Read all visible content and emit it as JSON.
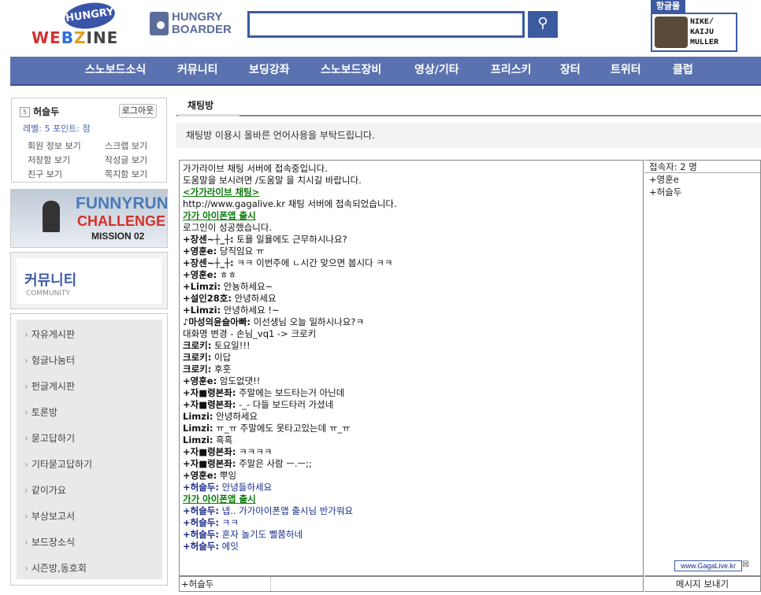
{
  "header": {
    "webzine_logo": {
      "hungry": "HUNGRY",
      "letters": [
        "WE",
        "B",
        "Z",
        "INE"
      ]
    },
    "boarder_logo": {
      "line1": "HUNGRY",
      "line2": "BOARDER"
    },
    "search": {
      "value": "",
      "placeholder": ""
    },
    "ad": {
      "tag": "항글몰",
      "text": [
        "NIKE/",
        "KAIJU",
        "MULLER"
      ]
    },
    "accent_color": "#3c5aa0"
  },
  "nav": {
    "items": [
      {
        "label": "스노보드소식"
      },
      {
        "label": "커뮤니티"
      },
      {
        "label": "보딩강좌"
      },
      {
        "label": "스노보드장비"
      },
      {
        "label": "영상/기타"
      },
      {
        "label": "프리스키"
      },
      {
        "label": "장터"
      },
      {
        "label": "트위터"
      },
      {
        "label": "클럽"
      }
    ]
  },
  "sidebar": {
    "user": {
      "name": "허슬두",
      "logout_label": "로그아웃",
      "level_text": "레벨: 5  포인트:         점"
    },
    "links": [
      "회원 정보 보기",
      "스크랩 보기",
      "저장함 보기",
      "작성글 보기",
      "친구 보기",
      "쪽지함 보기"
    ],
    "banner": {
      "line1": "FUNNYRUN",
      "line2": "CHALLENGE",
      "line3": "MISSION 02"
    },
    "community": {
      "title": "커뮤니티",
      "subtitle": "COMMUNITY"
    },
    "menu": [
      "자유게시판",
      "헝글나눔터",
      "펀글게시판",
      "토론방",
      "묻고답하기",
      "기타묻고답하기",
      "같이가요",
      "부상보고서",
      "보드장소식",
      "시즌방,동호회"
    ]
  },
  "chat": {
    "tab_label": "채팅방",
    "notice": "채팅방 이용시 올바른 언어사용을 부탁드립니다.",
    "lines": [
      {
        "nick": "",
        "text": "가가라이브 채팅 서버에 접속중입니다.",
        "style": "plain"
      },
      {
        "nick": "",
        "text": "도움말을 보시려면 /도움말 을 치시길 바랍니다.",
        "style": "plain"
      },
      {
        "nick": "",
        "text": "<가가라이브 채팅>",
        "style": "link"
      },
      {
        "nick": "",
        "text": "http://www.gagalive.kr 채팅 서버에 접속되었습니다.",
        "style": "plain"
      },
      {
        "nick": "",
        "text": " 가가 아이폰앱 출시",
        "style": "link"
      },
      {
        "nick": "",
        "text": "로그인이 성공했습니다.",
        "style": "plain"
      },
      {
        "nick": "+장센~┼_┼:",
        "text": " 토욜 일욜에도 근무하시나요?",
        "style": "plain"
      },
      {
        "nick": "+영훈e:",
        "text": " 당직임요 ㅠ",
        "style": "plain"
      },
      {
        "nick": "+장센~┼_┼:",
        "text": " ㅋㅋ 이번주에 ㄴ시간 맞으면 봅시다 ㅋㅋ",
        "style": "plain"
      },
      {
        "nick": "+영훈e:",
        "text": " ㅎㅎ",
        "style": "plain"
      },
      {
        "nick": "+Limzi:",
        "text": " 안뇽하세요~",
        "style": "plain"
      },
      {
        "nick": "+설인28호:",
        "text": " 안녕하세요",
        "style": "plain"
      },
      {
        "nick": "+Limzi:",
        "text": " 안녕하세요 !~",
        "style": "plain"
      },
      {
        "nick": "♪마성의윤슬아빠:",
        "text": " 이선생님 오늘 일하시나요?ㅋ",
        "style": "plain"
      },
      {
        "nick": "",
        "text": "대화명 변경 - 손님_vq1 -> 크로키",
        "style": "plain"
      },
      {
        "nick": "크로키:",
        "text": " 토요일!!!",
        "style": "plain"
      },
      {
        "nick": "크로키:",
        "text": " 이답",
        "style": "plain"
      },
      {
        "nick": "크로키:",
        "text": " 후훗",
        "style": "plain"
      },
      {
        "nick": "+영훈e:",
        "text": " 암도없댓!!",
        "style": "plain"
      },
      {
        "nick": "+자■령본좌:",
        "text": " 주말에는 보드타는거 아닌데",
        "style": "plain"
      },
      {
        "nick": "+자■령본좌:",
        "text": " -_- 다들 보드타러 가셨네",
        "style": "plain"
      },
      {
        "nick": "Limzi:",
        "text": " 안녕하세요",
        "style": "plain"
      },
      {
        "nick": "Limzi:",
        "text": " ㅠ_ㅠ 주말에도 못타고있는데 ㅠ_ㅠ",
        "style": "plain"
      },
      {
        "nick": "Limzi:",
        "text": " 흑흑",
        "style": "plain"
      },
      {
        "nick": "+자■령본좌:",
        "text": " ㅋㅋㅋㅋ",
        "style": "plain"
      },
      {
        "nick": "+자■령본좌:",
        "text": " 주말은 사람 ㅡ.ㅡ;;",
        "style": "plain"
      },
      {
        "nick": "+영훈e:",
        "text": " 뿌잉",
        "style": "plain"
      },
      {
        "nick": "+허슬두:",
        "text": " 안녕들하세요",
        "style": "blue"
      },
      {
        "nick": "",
        "text": " 가가 아이폰앱 출시",
        "style": "link"
      },
      {
        "nick": "+허슬두:",
        "text": " 넵.. 가가아이폰앱 출시님 반가워요",
        "style": "blue"
      },
      {
        "nick": "+허슬두:",
        "text": " ㅋㅋ",
        "style": "blue"
      },
      {
        "nick": "+허슬두:",
        "text": " 혼자 놀기도 뻘쭘하네",
        "style": "blue"
      },
      {
        "nick": "+허슬두:",
        "text": " 에잇",
        "style": "blue"
      }
    ],
    "users_header": "접속자: 2 명",
    "users": [
      "+영훈e",
      "+허슬두"
    ],
    "gaga_badge": "www.GagaLive.kr",
    "input_nick": "+허슬두",
    "input_value": "",
    "send_label": "메시지 보내기"
  }
}
